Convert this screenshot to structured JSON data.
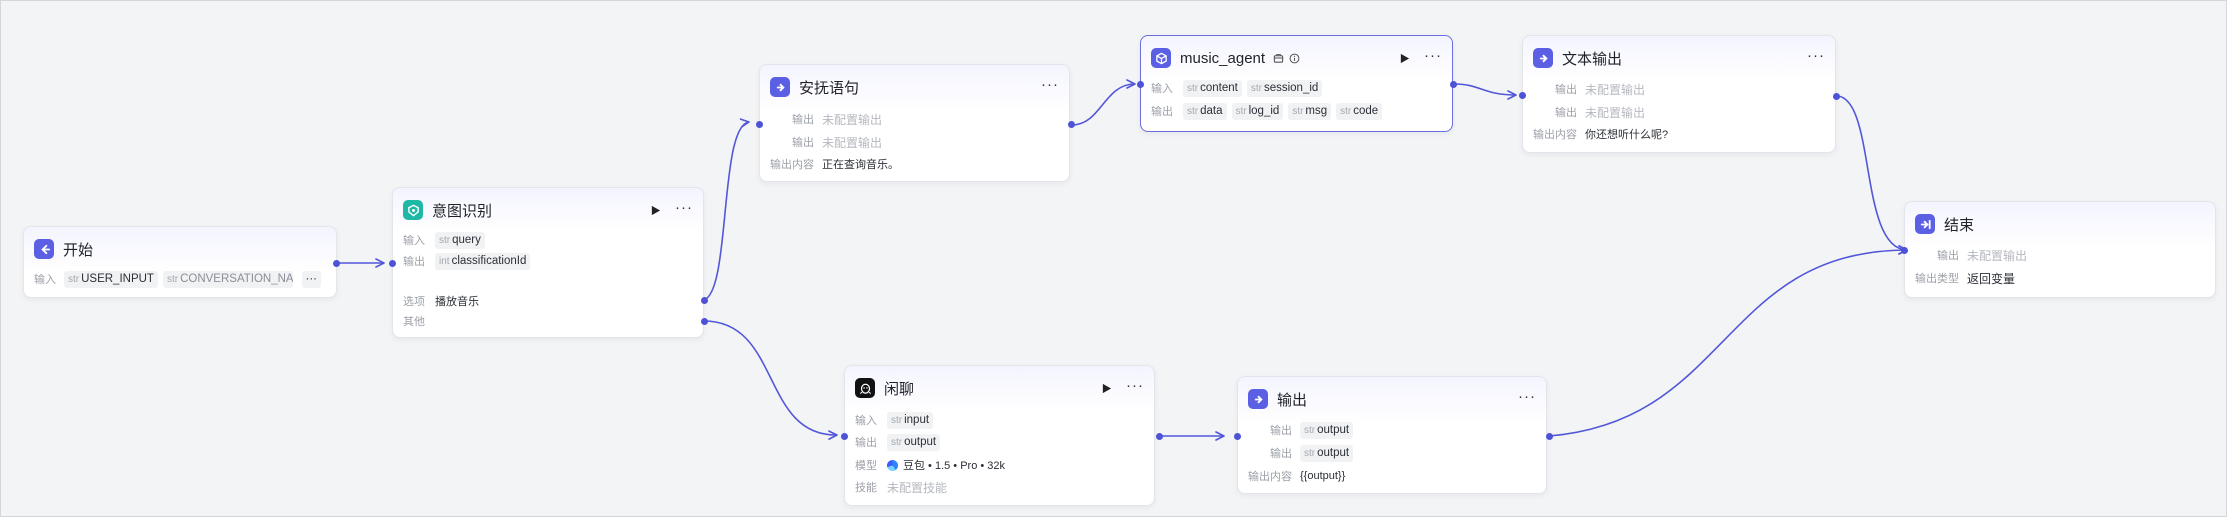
{
  "colors": {
    "edge": "#5257d8",
    "accent": "#5b5fe3",
    "teal": "#1fb8a6"
  },
  "nodes": {
    "start": {
      "title": "开始",
      "icon": "start-icon",
      "input_label": "输入",
      "inputs": [
        {
          "type": "str",
          "name": "USER_INPUT"
        },
        {
          "type": "str",
          "name": "CONVERSATION_NAME"
        }
      ],
      "more": "···"
    },
    "intent": {
      "title": "意图识别",
      "icon": "intent-icon",
      "input_label": "输入",
      "output_label": "输出",
      "input": {
        "type": "str",
        "name": "query"
      },
      "output": {
        "type": "int",
        "name": "classificationId"
      },
      "option_label": "选项",
      "option_value": "播放音乐",
      "other_label": "其他",
      "more": "···"
    },
    "soothe": {
      "title": "安抚语句",
      "icon": "output-icon",
      "output_label": "输出",
      "not_configured": "未配置输出",
      "content_label": "输出内容",
      "content_value": "正在查询音乐。",
      "more": "···"
    },
    "music_agent": {
      "title": "music_agent",
      "icon": "agent-icon",
      "input_label": "输入",
      "output_label": "输出",
      "inputs": [
        {
          "type": "str",
          "name": "content"
        },
        {
          "type": "str",
          "name": "session_id"
        }
      ],
      "outputs": [
        {
          "type": "str",
          "name": "data"
        },
        {
          "type": "str",
          "name": "log_id"
        },
        {
          "type": "str",
          "name": "msg"
        },
        {
          "type": "str",
          "name": "code"
        }
      ],
      "more": "···"
    },
    "text_output": {
      "title": "文本输出",
      "icon": "output-icon",
      "output_label": "输出",
      "not_configured": "未配置输出",
      "content_label": "输出内容",
      "content_value": "你还想听什么呢?",
      "more": "···"
    },
    "end": {
      "title": "结束",
      "icon": "end-icon",
      "output_label": "输出",
      "not_configured": "未配置输出",
      "type_label": "输出类型",
      "type_value": "返回变量"
    },
    "chat": {
      "title": "闲聊",
      "icon": "chat-icon",
      "input_label": "输入",
      "output_label": "输出",
      "model_label": "模型",
      "skill_label": "技能",
      "input": {
        "type": "str",
        "name": "input"
      },
      "output": {
        "type": "str",
        "name": "output"
      },
      "model_value": "豆包 • 1.5 • Pro • 32k",
      "skill_value": "未配置技能",
      "more": "···"
    },
    "output": {
      "title": "输出",
      "icon": "output-icon",
      "output_label": "输出",
      "outputs": [
        {
          "type": "str",
          "name": "output"
        },
        {
          "type": "str",
          "name": "output"
        }
      ],
      "content_label": "输出内容",
      "content_value": "{{output}}",
      "more": "···"
    }
  }
}
